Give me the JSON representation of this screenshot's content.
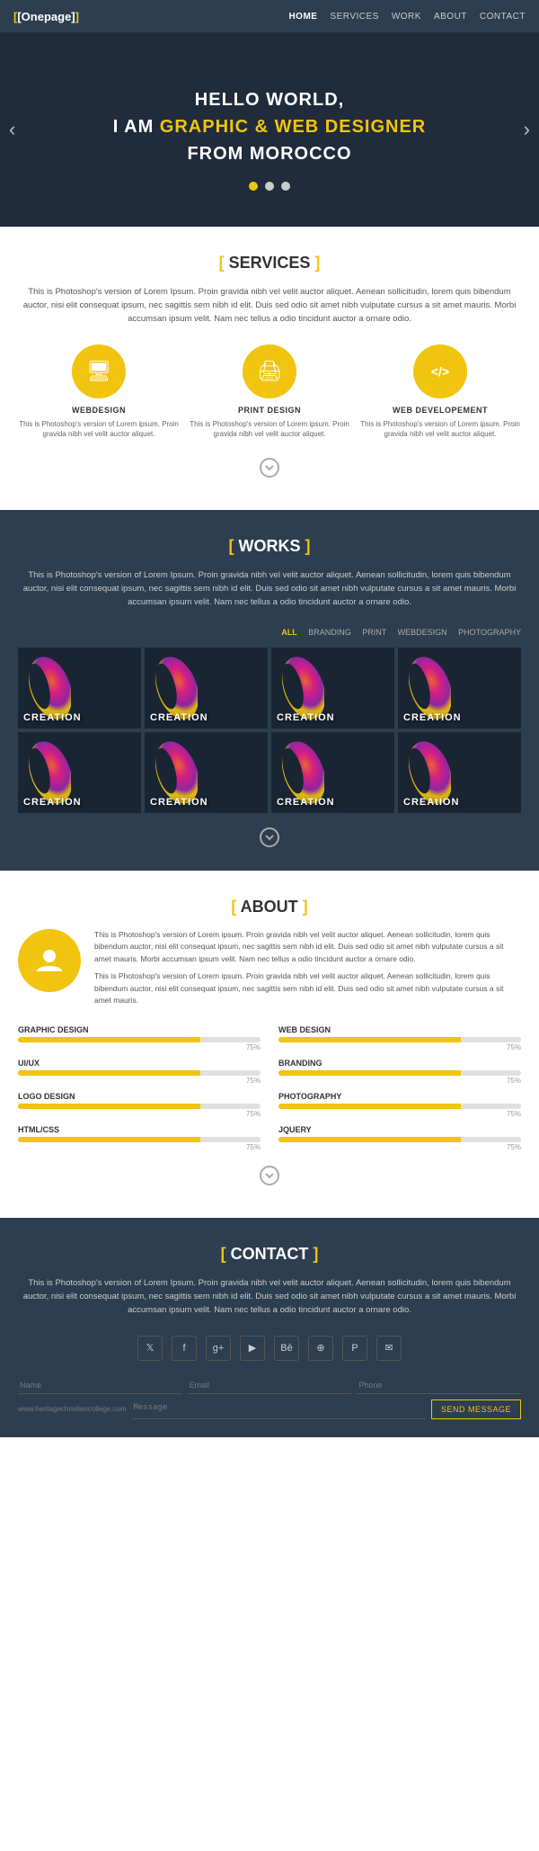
{
  "nav": {
    "brand": "[Onepage]",
    "links": [
      "HOME",
      "SERVICES",
      "WORK",
      "ABOUT",
      "CONTACT"
    ],
    "active": "HOME"
  },
  "hero": {
    "line1": "HELLO WORLD,",
    "line2_pre": "I AM ",
    "line2_highlight": "GRAPHIC & WEB DESIGNER",
    "line3": "FROM MOROCCO",
    "dots": [
      true,
      false,
      false
    ]
  },
  "services": {
    "section_title_bracket_open": "[",
    "section_title": "SERVICES",
    "section_title_bracket_close": "]",
    "desc": "This is Photoshop's version of Lorem Ipsum. Proin gravida nibh vel velit auctor aliquet. Aenean sollicitudin, lorem quis bibendum auctor,\nnisi elit consequat ipsum, nec sagittis sem nibh id elit. Duis sed odio sit amet nibh vulputate cursus a sit amet mauris. Morbi accumsan\nipsum velit. Nam nec tellus a odio tincidunt auctor a ornare odio.",
    "items": [
      {
        "name": "WEBDESIGN",
        "icon": "🖥",
        "desc": "This is Photoshop's version of Lorem ipsum. Proin gravida nibh vel velit auctor aliquet."
      },
      {
        "name": "PRINT DESIGN",
        "icon": "🖨",
        "desc": "This is Photoshop's version of Lorem ipsum. Proin gravida nibh vel velit auctor aliquet."
      },
      {
        "name": "WEB DEVELOPEMENT",
        "icon": "</>",
        "desc": "This is Photoshop's version of Lorem ipsum. Proin gravida nibh vel velit auctor aliquet."
      }
    ]
  },
  "works": {
    "section_title_bracket_open": "[",
    "section_title": "WORKS",
    "section_title_bracket_close": "]",
    "desc": "This is Photoshop's version of Lorem Ipsum. Proin gravida nibh vel velit auctor aliquet. Aenean sollicitudin, lorem quis bibendum auctor,\nnisi elit consequat ipsum, nec sagittis sem nibh id elit. Duis sed odio sit amet nibh vulputate cursus a sit amet mauris. Morbi accumsan\nipsum velit. Nam nec tellus a odio tincidunt auctor a ornare odio.",
    "filters": [
      "ALL",
      "BRANDING",
      "PRINT",
      "WEBDESIGN",
      "PHOTOGRAPHY"
    ],
    "active_filter": "ALL",
    "items": [
      "CREATION",
      "CREATION",
      "CREATION",
      "CREATION",
      "CREATION",
      "CREATION",
      "CREATION",
      "CREAtION"
    ]
  },
  "about": {
    "section_title_bracket_open": "[",
    "section_title": "ABOUT",
    "section_title_bracket_close": "]",
    "text1": "This is Photoshop's version of Lorem ipsum. Proin gravida nibh vel velit auctor aliquet. Aenean sollicitudin, lorem quis bibendum auctor, nisi elit consequat ipsum, nec sagittis sem nibh id elit. Duis sed odio sit amet nibh vulputate cursus a sit amet mauris. Morbi accumsan ipsum velit. Nam nec tellus a odio tincidunt auctor a ornare odio.",
    "text2": "This is Photoshop's version of Lorem ipsum. Proin gravida nibh vel velit auctor aliquet. Aenean sollicitudin, lorem quis bibendum auctor, nisi elit consequat ipsum, nec sagittis sem nibh id elit. Duis sed odio sit amet nibh vulputate cursus a sit amet mauris.",
    "skills": [
      {
        "name": "GRAPHIC DESIGN",
        "pct": 75
      },
      {
        "name": "WEB DESIGN",
        "pct": 75
      },
      {
        "name": "UI/UX",
        "pct": 75
      },
      {
        "name": "BRANDING",
        "pct": 75
      },
      {
        "name": "LOGO DESIGN",
        "pct": 75
      },
      {
        "name": "PHOTOGRAPHY",
        "pct": 75
      },
      {
        "name": "HTML/CSS",
        "pct": 75
      },
      {
        "name": "JQUERY",
        "pct": 75
      }
    ]
  },
  "contact": {
    "section_title_bracket_open": "[",
    "section_title": "CONTACT",
    "section_title_bracket_close": "]",
    "desc": "This is Photoshop's version of Lorem Ipsum. Proin gravida nibh vel velit auctor aliquet. Aenean sollicitudin, lorem quis bibendum auctor,\nnisi elit consequat ipsum, nec sagittis sem nibh id elit. Duis sed odio sit amet nibh vulputate cursus a sit amet mauris. Morbi accumsan\nipsum velit. Nam nec tellus a odio tincidunt auctor a ornare odio.",
    "social_icons": [
      "𝕏",
      "f",
      "g+",
      "▶",
      "Bē",
      "🌐",
      "P",
      "✉"
    ],
    "fields": {
      "name_placeholder": "Name",
      "email_placeholder": "Email",
      "phone_placeholder": "Phone",
      "message_placeholder": "Message"
    },
    "url": "www.heritagechristiancollege.com",
    "send_label": "SEND MESSAGE"
  },
  "scroll_down_char": "⌄"
}
